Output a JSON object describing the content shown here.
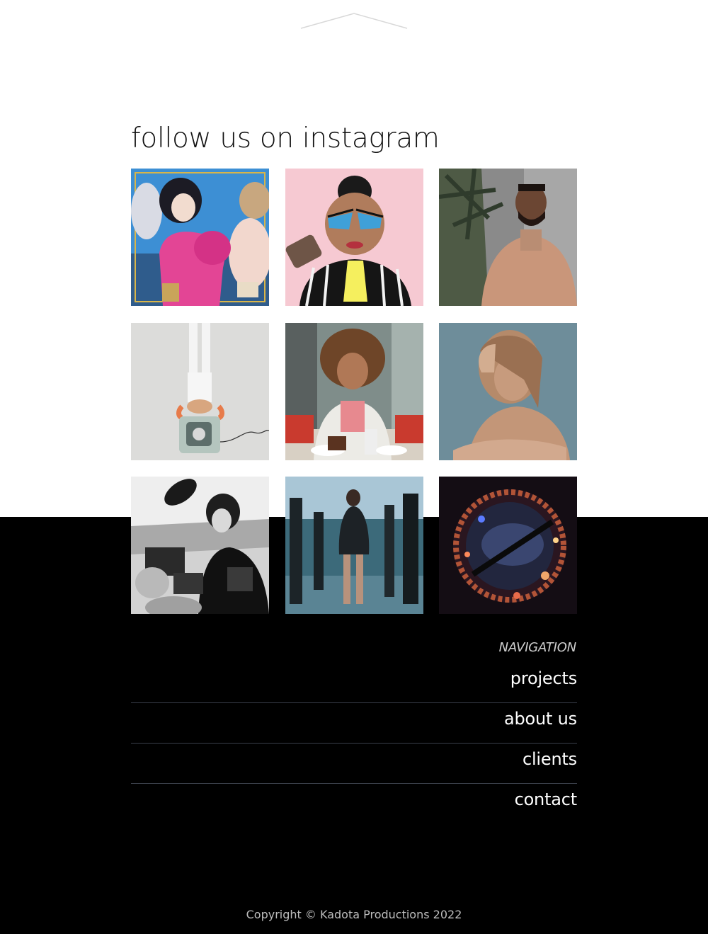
{
  "instagram": {
    "title": "follow us on instagram",
    "posts": [
      {
        "alt": "glam-portrait-post"
      },
      {
        "alt": "drag-makeup-post"
      },
      {
        "alt": "man-in-tan-suit-post"
      },
      {
        "alt": "handstand-on-tv-post"
      },
      {
        "alt": "woman-at-diner-post"
      },
      {
        "alt": "woman-portrait-post"
      },
      {
        "alt": "paparazzi-bw-post"
      },
      {
        "alt": "runway-models-post"
      },
      {
        "alt": "fisheye-night-post"
      }
    ]
  },
  "footer": {
    "nav_heading": "NAVIGATION",
    "nav_items": [
      {
        "label": "projects"
      },
      {
        "label": "about us"
      },
      {
        "label": "clients"
      },
      {
        "label": "contact"
      }
    ],
    "copyright": "Copyright © Kadota Productions 2022"
  },
  "colors": {
    "background": "#ffffff",
    "footer_background": "#000000",
    "divider": "#3a3f4a"
  }
}
